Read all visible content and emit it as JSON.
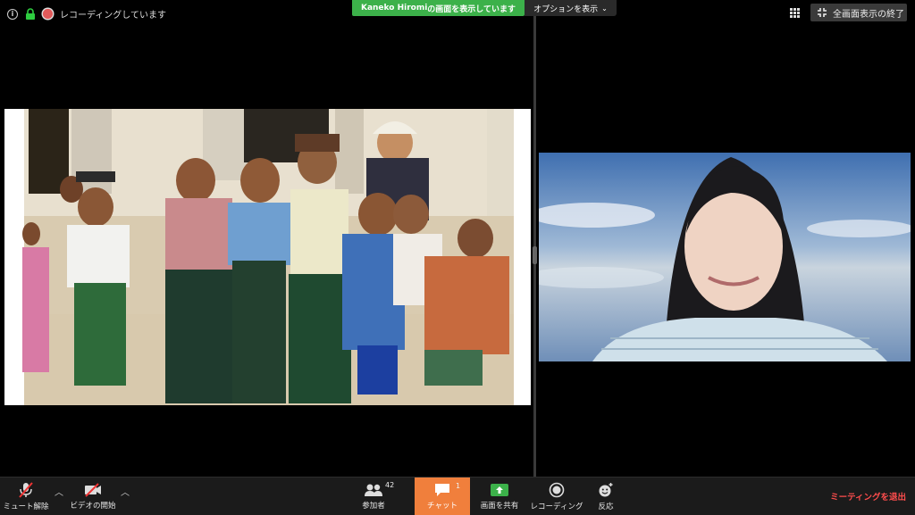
{
  "top_bar": {
    "recording_text": "レコーディングしています",
    "share_banner": {
      "name": "Kaneko Hiromi",
      "suffix": " の画面を表示しています"
    },
    "options_label": "オプションを表示",
    "exit_fullscreen_label": "全画面表示の終了"
  },
  "toolbar": {
    "mute_label": "ミュート解除",
    "video_label": "ビデオの開始",
    "participants_label": "参加者",
    "participants_count": "42",
    "chat_label": "チャット",
    "chat_count": "1",
    "share_label": "画面を共有",
    "record_label": "レコーディング",
    "reactions_label": "反応",
    "leave_label": "ミーティングを退出"
  },
  "colors": {
    "share_banner": "#3cb14a",
    "chat_active": "#f07f3c",
    "leave": "#ff4d4d",
    "recording": "#e05a5a"
  }
}
